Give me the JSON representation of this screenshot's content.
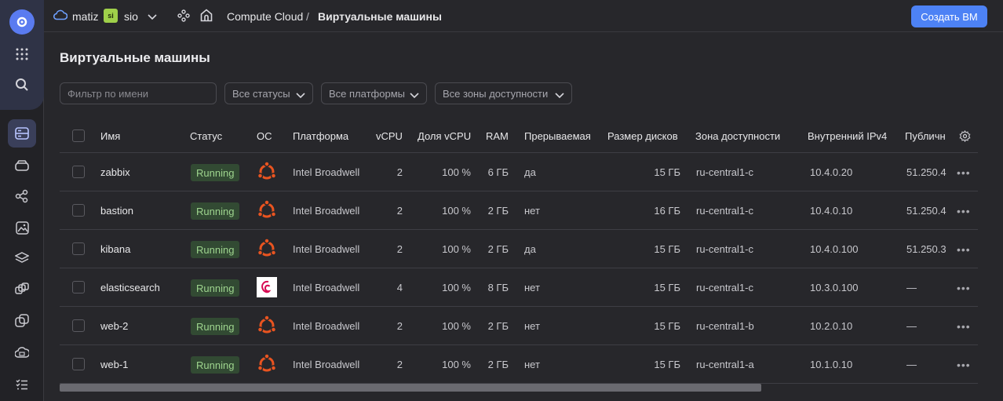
{
  "header": {
    "cloud_name": "matiz",
    "folder_badge": "si",
    "folder_name": "sio",
    "service": "Compute Cloud",
    "separator": "/",
    "current_page": "Виртуальные машины",
    "create_button": "Создать ВМ"
  },
  "page": {
    "title": "Виртуальные машины"
  },
  "filters": {
    "name_placeholder": "Фильтр по имени",
    "status_select": "Все статусы",
    "platform_select": "Все платформы",
    "zone_select": "Все зоны доступности"
  },
  "table": {
    "columns": [
      "Имя",
      "Статус",
      "ОС",
      "Платформа",
      "vCPU",
      "Доля vCPU",
      "RAM",
      "Прерываемая",
      "Размер дисков",
      "Зона доступности",
      "Внутренний IPv4",
      "Публичн"
    ],
    "rows": [
      {
        "name": "zabbix",
        "status": "Running",
        "os": "ubuntu-icon",
        "platform": "Intel Broadwell",
        "vcpu": "2",
        "share": "100 %",
        "ram": "6 ГБ",
        "preemptible": "да",
        "disk": "15 ГБ",
        "zone": "ru-central1-c",
        "ipv4": "10.4.0.20",
        "public": "51.250.4"
      },
      {
        "name": "bastion",
        "status": "Running",
        "os": "ubuntu-icon",
        "platform": "Intel Broadwell",
        "vcpu": "2",
        "share": "100 %",
        "ram": "2 ГБ",
        "preemptible": "нет",
        "disk": "16 ГБ",
        "zone": "ru-central1-c",
        "ipv4": "10.4.0.10",
        "public": "51.250.4"
      },
      {
        "name": "kibana",
        "status": "Running",
        "os": "ubuntu-icon",
        "platform": "Intel Broadwell",
        "vcpu": "2",
        "share": "100 %",
        "ram": "2 ГБ",
        "preemptible": "да",
        "disk": "15 ГБ",
        "zone": "ru-central1-c",
        "ipv4": "10.4.0.100",
        "public": "51.250.3"
      },
      {
        "name": "elasticsearch",
        "status": "Running",
        "os": "debian-icon",
        "platform": "Intel Broadwell",
        "vcpu": "4",
        "share": "100 %",
        "ram": "8 ГБ",
        "preemptible": "нет",
        "disk": "15 ГБ",
        "zone": "ru-central1-c",
        "ipv4": "10.3.0.100",
        "public": "—"
      },
      {
        "name": "web-2",
        "status": "Running",
        "os": "ubuntu-icon",
        "platform": "Intel Broadwell",
        "vcpu": "2",
        "share": "100 %",
        "ram": "2 ГБ",
        "preemptible": "нет",
        "disk": "15 ГБ",
        "zone": "ru-central1-b",
        "ipv4": "10.2.0.10",
        "public": "—"
      },
      {
        "name": "web-1",
        "status": "Running",
        "os": "ubuntu-icon",
        "platform": "Intel Broadwell",
        "vcpu": "2",
        "share": "100 %",
        "ram": "2 ГБ",
        "preemptible": "нет",
        "disk": "15 ГБ",
        "zone": "ru-central1-a",
        "ipv4": "10.1.0.10",
        "public": "—"
      }
    ]
  },
  "colors": {
    "accent": "#4d82f5",
    "running_bg": "#324a33",
    "running_text": "#9ed48e",
    "ubuntu": "#e95420",
    "debian": "#d70a53"
  }
}
